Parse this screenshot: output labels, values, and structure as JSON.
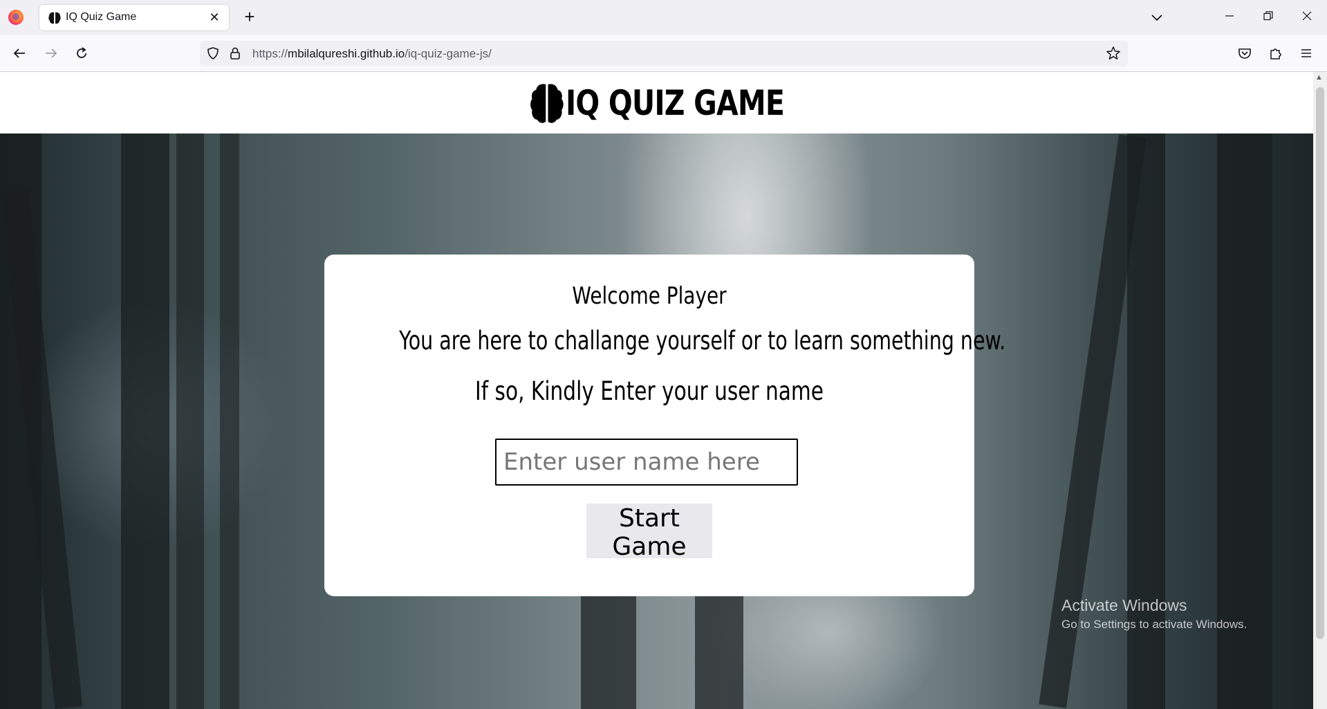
{
  "browser": {
    "tab": {
      "title": "IQ Quiz Game",
      "close": "✕"
    },
    "new_tab": "+",
    "url": {
      "prefix": "https://",
      "host": "mbilalqureshi.github.io",
      "path": "/iq-quiz-game-js/"
    }
  },
  "site": {
    "title": "IQ QUIZ GAME"
  },
  "welcome": {
    "heading": "Welcome Player",
    "line1": "You are here to challange yourself or to learn something new.",
    "line2": "If so, Kindly Enter your user name",
    "input_value": "",
    "input_placeholder": "Enter user name here",
    "start_button": "Start Game"
  },
  "os_watermark": {
    "line1": "Activate Windows",
    "line2": "Go to Settings to activate Windows."
  },
  "colors": {
    "card_bg": "#ffffff",
    "button_bg": "#e9e9ed",
    "browser_bg": "#f0f0f4"
  }
}
